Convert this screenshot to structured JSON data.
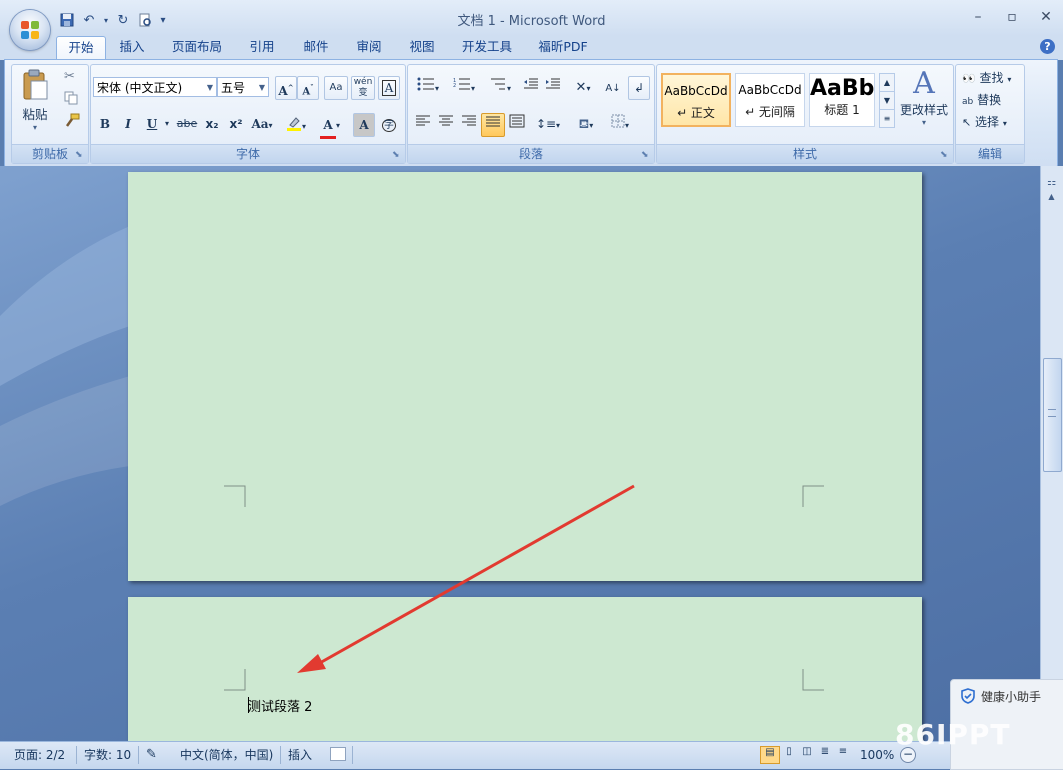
{
  "window": {
    "title": "文档 1 - Microsoft Word",
    "minimize_icon": "minimize-icon",
    "maximize_icon": "maximize-icon",
    "close_icon": "close-icon"
  },
  "qat": {
    "customize_glyph": "▾"
  },
  "tabs": [
    "开始",
    "插入",
    "页面布局",
    "引用",
    "邮件",
    "审阅",
    "视图",
    "开发工具",
    "福昕PDF"
  ],
  "ribbon": {
    "clipboard": {
      "paste_label": "粘贴",
      "group_label": "剪贴板"
    },
    "font": {
      "font_name": "宋体 (中文正文)",
      "font_size": "五号",
      "group_label": "字体",
      "bold": "B",
      "italic": "I",
      "underline": "U",
      "strike": "abe",
      "subscript": "x₂",
      "superscript": "x²",
      "change_case": "Aa",
      "grow": "A",
      "shrink": "A",
      "phonetic": "wén",
      "border_char": "A",
      "shade_char": "A",
      "enclose_char": "字"
    },
    "paragraph": {
      "group_label": "段落"
    },
    "styles": {
      "group_label": "样式",
      "items": [
        {
          "sample": "AaBbCcDd",
          "name": "↵ 正文"
        },
        {
          "sample": "AaBbCcDd",
          "name": "↵ 无间隔"
        },
        {
          "sample": "AaBb",
          "name": "标题 1"
        }
      ],
      "change_styles_label": "更改样式"
    },
    "editing": {
      "group_label": "编辑",
      "find_label": "查找",
      "replace_label": "替换",
      "select_label": "选择"
    }
  },
  "document": {
    "paragraph_text": "测试段落 2",
    "page_color": "#cde8d1"
  },
  "status": {
    "page": "页面: 2/2",
    "words": "字数: 10",
    "language": "中文(简体，中国)",
    "mode": "插入",
    "zoom": "100%"
  },
  "helper": {
    "label": "健康小助手"
  },
  "watermark": "86IPPT",
  "colors": {
    "arrow": "#e23a30",
    "accent": "#15428b"
  }
}
